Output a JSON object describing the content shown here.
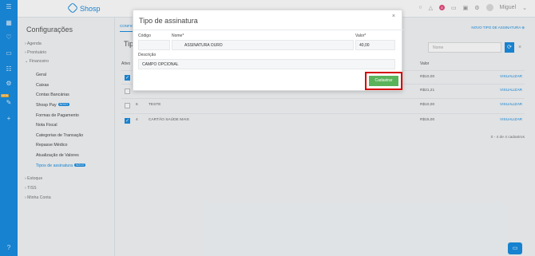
{
  "rail": {
    "icons": [
      "menu-icon",
      "calendar-icon",
      "heart-icon",
      "money-icon",
      "list-icon",
      "settings-icon",
      "new-icon",
      "plus-icon"
    ],
    "new_tag": "NEW",
    "help_icon": "help-icon"
  },
  "topbar": {
    "brand": "Shosp",
    "tab_label": "CONFIG",
    "notification_count": "8",
    "user": "Miguel"
  },
  "sidebar": {
    "title": "Configurações",
    "items": [
      "Agenda",
      "Prontuário",
      "Financeiro",
      "Estoque",
      "TISS",
      "Minha Conta"
    ],
    "financeiro_subitems": [
      "Geral",
      "Caixas",
      "Contas Bancárias",
      "Shosp Pay",
      "Formas de Pagamento",
      "Nota Fiscal",
      "Categorias de Transação",
      "Repasse Médico",
      "Atualização de Valores",
      "Tipos de assinatura"
    ],
    "new_tag": "NOVO"
  },
  "main": {
    "title": "Tip",
    "new_type_link": "NOVO TIPO DE ASSINATURA ⊕",
    "search_placeholder": "Nome",
    "table_header": {
      "ativo": "Ativo",
      "valor": "Valor"
    },
    "rows": [
      {
        "code": "",
        "name": "",
        "value": "R$10,00",
        "action": "VISUALIZAR",
        "checked": true
      },
      {
        "code": "",
        "name": "TESTE",
        "value": "R$21,21",
        "action": "VISUALIZAR",
        "checked": false
      },
      {
        "code": "6",
        "name": "TESTE",
        "value": "R$10,00",
        "action": "VISUALIZAR",
        "checked": false
      },
      {
        "code": "4",
        "name": "CARTÃO SAÚDE MAIS",
        "value": "R$15,00",
        "action": "VISUALIZAR",
        "checked": true
      }
    ],
    "pager": "0 - 4 de 4 cadastros"
  },
  "modal": {
    "title": "Tipo de assinatura",
    "close": "×",
    "labels": {
      "codigo": "Código",
      "nome": "Nome*",
      "valor": "Valor*",
      "descricao": "Descrição"
    },
    "values": {
      "codigo": "",
      "nome": "ASSINATURA OURO",
      "valor": "40,00",
      "descricao": "CAMPO OPCIONAL"
    },
    "save_label": "Cadastrar"
  }
}
